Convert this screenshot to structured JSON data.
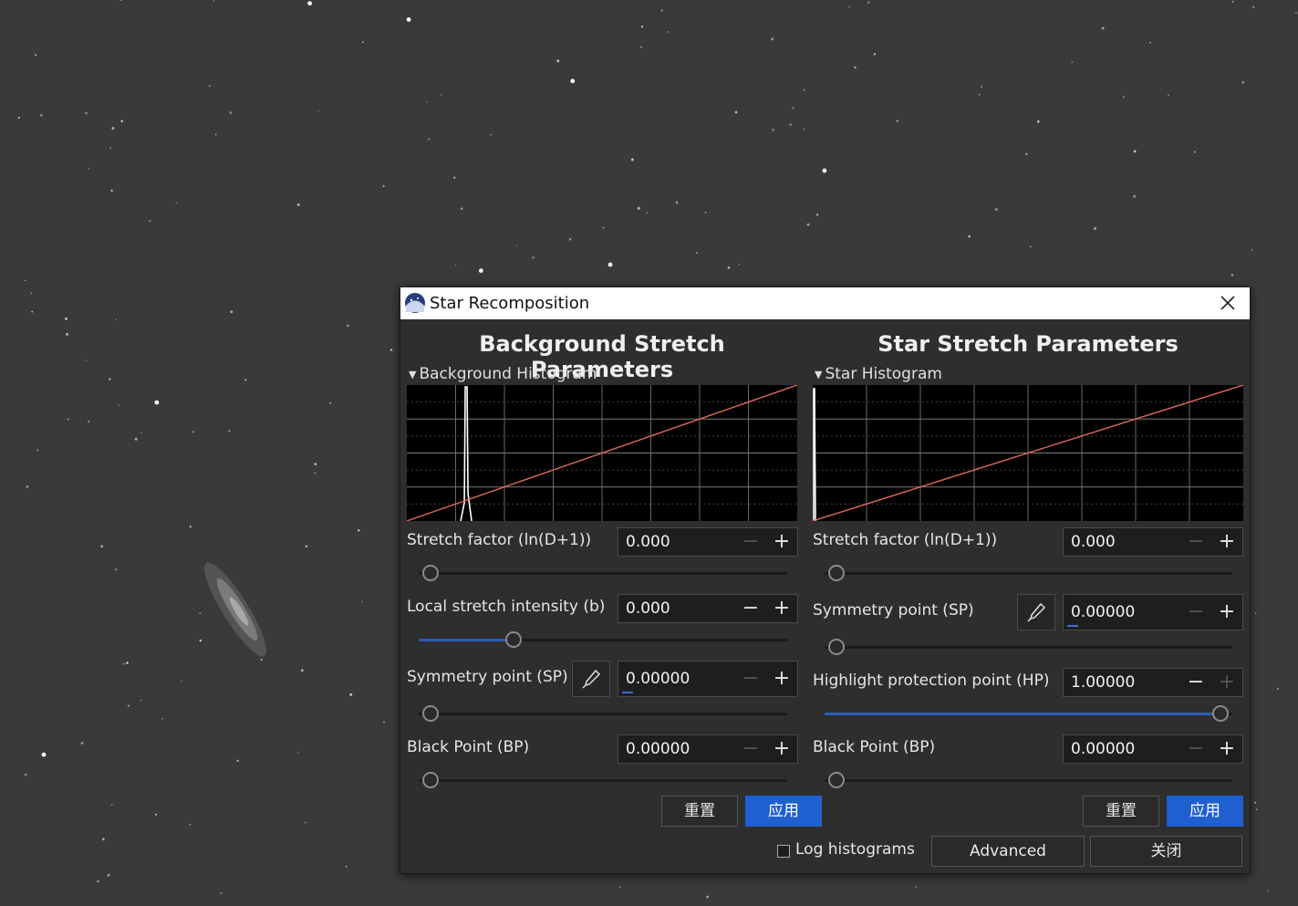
{
  "window": {
    "title": "Star Recomposition",
    "app_icon": "siril-logo-icon",
    "close_icon": "close-icon"
  },
  "background": {
    "heading": "Background Stretch Parameters",
    "histogram_toggle": "Background Histogram",
    "stretch_factor": {
      "label": "Stretch factor (ln(D+1))",
      "value": "0.000",
      "slider_fraction": 0.0
    },
    "local_intensity": {
      "label": "Local stretch intensity (b)",
      "value": "0.000",
      "slider_fraction": 0.24
    },
    "symmetry_point": {
      "label": "Symmetry point (SP)",
      "value": "0.00000",
      "slider_fraction": 0.0
    },
    "black_point": {
      "label": "Black Point (BP)",
      "value": "0.00000",
      "slider_fraction": 0.0
    },
    "reset_label": "重置",
    "apply_label": "应用"
  },
  "star": {
    "heading": "Star Stretch Parameters",
    "histogram_toggle": "Star Histogram",
    "stretch_factor": {
      "label": "Stretch factor (ln(D+1))",
      "value": "0.000",
      "slider_fraction": 0.0
    },
    "symmetry_point": {
      "label": "Symmetry point (SP)",
      "value": "0.00000",
      "slider_fraction": 0.0
    },
    "highlight_protection": {
      "label": "Highlight protection point (HP)",
      "value": "1.00000",
      "slider_fraction": 1.0
    },
    "black_point": {
      "label": "Black Point (BP)",
      "value": "0.00000",
      "slider_fraction": 0.0
    },
    "reset_label": "重置",
    "apply_label": "应用"
  },
  "footer": {
    "log_histograms_label": "Log histograms",
    "log_histograms_checked": false,
    "advanced_label": "Advanced",
    "close_label": "关闭"
  },
  "colors": {
    "accent": "#1f5fd0",
    "curve": "#e06a5a",
    "histogram_peak": "#ffffff"
  }
}
